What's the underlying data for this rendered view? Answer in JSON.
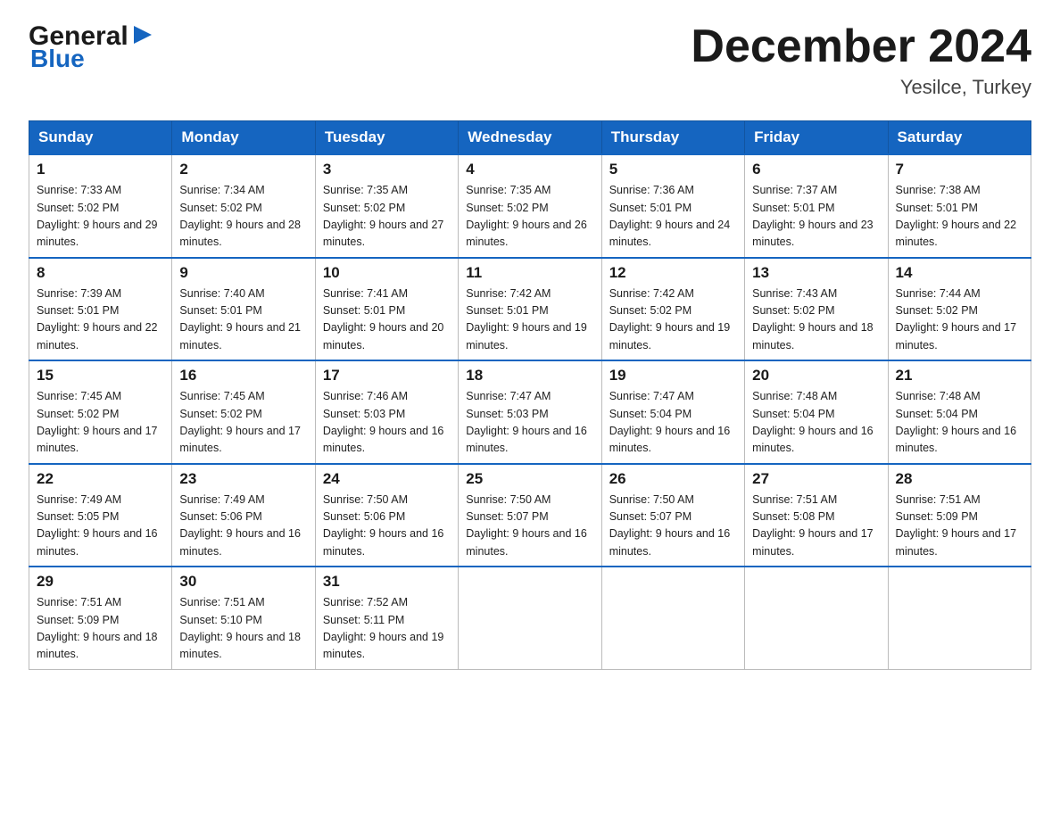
{
  "logo": {
    "general": "General",
    "blue": "Blue",
    "arrow": "▶"
  },
  "title": "December 2024",
  "subtitle": "Yesilce, Turkey",
  "days_of_week": [
    "Sunday",
    "Monday",
    "Tuesday",
    "Wednesday",
    "Thursday",
    "Friday",
    "Saturday"
  ],
  "weeks": [
    [
      {
        "date": "1",
        "sunrise": "7:33 AM",
        "sunset": "5:02 PM",
        "daylight": "9 hours and 29 minutes."
      },
      {
        "date": "2",
        "sunrise": "7:34 AM",
        "sunset": "5:02 PM",
        "daylight": "9 hours and 28 minutes."
      },
      {
        "date": "3",
        "sunrise": "7:35 AM",
        "sunset": "5:02 PM",
        "daylight": "9 hours and 27 minutes."
      },
      {
        "date": "4",
        "sunrise": "7:35 AM",
        "sunset": "5:02 PM",
        "daylight": "9 hours and 26 minutes."
      },
      {
        "date": "5",
        "sunrise": "7:36 AM",
        "sunset": "5:01 PM",
        "daylight": "9 hours and 24 minutes."
      },
      {
        "date": "6",
        "sunrise": "7:37 AM",
        "sunset": "5:01 PM",
        "daylight": "9 hours and 23 minutes."
      },
      {
        "date": "7",
        "sunrise": "7:38 AM",
        "sunset": "5:01 PM",
        "daylight": "9 hours and 22 minutes."
      }
    ],
    [
      {
        "date": "8",
        "sunrise": "7:39 AM",
        "sunset": "5:01 PM",
        "daylight": "9 hours and 22 minutes."
      },
      {
        "date": "9",
        "sunrise": "7:40 AM",
        "sunset": "5:01 PM",
        "daylight": "9 hours and 21 minutes."
      },
      {
        "date": "10",
        "sunrise": "7:41 AM",
        "sunset": "5:01 PM",
        "daylight": "9 hours and 20 minutes."
      },
      {
        "date": "11",
        "sunrise": "7:42 AM",
        "sunset": "5:01 PM",
        "daylight": "9 hours and 19 minutes."
      },
      {
        "date": "12",
        "sunrise": "7:42 AM",
        "sunset": "5:02 PM",
        "daylight": "9 hours and 19 minutes."
      },
      {
        "date": "13",
        "sunrise": "7:43 AM",
        "sunset": "5:02 PM",
        "daylight": "9 hours and 18 minutes."
      },
      {
        "date": "14",
        "sunrise": "7:44 AM",
        "sunset": "5:02 PM",
        "daylight": "9 hours and 17 minutes."
      }
    ],
    [
      {
        "date": "15",
        "sunrise": "7:45 AM",
        "sunset": "5:02 PM",
        "daylight": "9 hours and 17 minutes."
      },
      {
        "date": "16",
        "sunrise": "7:45 AM",
        "sunset": "5:02 PM",
        "daylight": "9 hours and 17 minutes."
      },
      {
        "date": "17",
        "sunrise": "7:46 AM",
        "sunset": "5:03 PM",
        "daylight": "9 hours and 16 minutes."
      },
      {
        "date": "18",
        "sunrise": "7:47 AM",
        "sunset": "5:03 PM",
        "daylight": "9 hours and 16 minutes."
      },
      {
        "date": "19",
        "sunrise": "7:47 AM",
        "sunset": "5:04 PM",
        "daylight": "9 hours and 16 minutes."
      },
      {
        "date": "20",
        "sunrise": "7:48 AM",
        "sunset": "5:04 PM",
        "daylight": "9 hours and 16 minutes."
      },
      {
        "date": "21",
        "sunrise": "7:48 AM",
        "sunset": "5:04 PM",
        "daylight": "9 hours and 16 minutes."
      }
    ],
    [
      {
        "date": "22",
        "sunrise": "7:49 AM",
        "sunset": "5:05 PM",
        "daylight": "9 hours and 16 minutes."
      },
      {
        "date": "23",
        "sunrise": "7:49 AM",
        "sunset": "5:06 PM",
        "daylight": "9 hours and 16 minutes."
      },
      {
        "date": "24",
        "sunrise": "7:50 AM",
        "sunset": "5:06 PM",
        "daylight": "9 hours and 16 minutes."
      },
      {
        "date": "25",
        "sunrise": "7:50 AM",
        "sunset": "5:07 PM",
        "daylight": "9 hours and 16 minutes."
      },
      {
        "date": "26",
        "sunrise": "7:50 AM",
        "sunset": "5:07 PM",
        "daylight": "9 hours and 16 minutes."
      },
      {
        "date": "27",
        "sunrise": "7:51 AM",
        "sunset": "5:08 PM",
        "daylight": "9 hours and 17 minutes."
      },
      {
        "date": "28",
        "sunrise": "7:51 AM",
        "sunset": "5:09 PM",
        "daylight": "9 hours and 17 minutes."
      }
    ],
    [
      {
        "date": "29",
        "sunrise": "7:51 AM",
        "sunset": "5:09 PM",
        "daylight": "9 hours and 18 minutes."
      },
      {
        "date": "30",
        "sunrise": "7:51 AM",
        "sunset": "5:10 PM",
        "daylight": "9 hours and 18 minutes."
      },
      {
        "date": "31",
        "sunrise": "7:52 AM",
        "sunset": "5:11 PM",
        "daylight": "9 hours and 19 minutes."
      },
      null,
      null,
      null,
      null
    ]
  ]
}
